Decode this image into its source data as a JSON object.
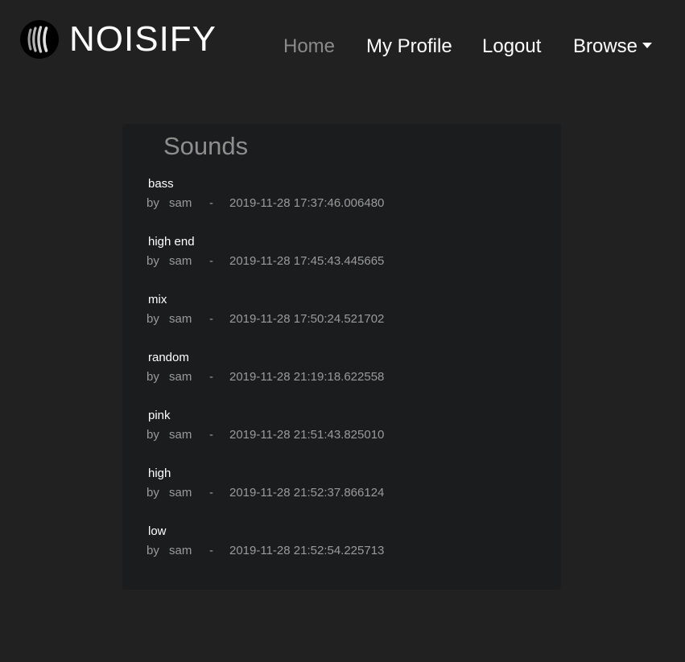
{
  "brand": {
    "name": "NOISIFY",
    "logo_icon": "sound-waves-icon"
  },
  "nav": {
    "home": "Home",
    "profile": "My Profile",
    "logout": "Logout",
    "browse": "Browse"
  },
  "colors": {
    "background": "#212121",
    "card": "#1b1c1e",
    "active_link": "#8a8a8a",
    "text": "#ffffff",
    "muted": "#9a9a9a"
  },
  "sounds_panel": {
    "title": "Sounds",
    "by_label": "by",
    "separator": "-",
    "items": [
      {
        "name": "bass",
        "user": "sam",
        "timestamp": "2019-11-28 17:37:46.006480"
      },
      {
        "name": "high end",
        "user": "sam",
        "timestamp": "2019-11-28 17:45:43.445665"
      },
      {
        "name": "mix",
        "user": "sam",
        "timestamp": "2019-11-28 17:50:24.521702"
      },
      {
        "name": "random",
        "user": "sam",
        "timestamp": "2019-11-28 21:19:18.622558"
      },
      {
        "name": "pink",
        "user": "sam",
        "timestamp": "2019-11-28 21:51:43.825010"
      },
      {
        "name": "high",
        "user": "sam",
        "timestamp": "2019-11-28 21:52:37.866124"
      },
      {
        "name": "low",
        "user": "sam",
        "timestamp": "2019-11-28 21:52:54.225713"
      }
    ]
  }
}
